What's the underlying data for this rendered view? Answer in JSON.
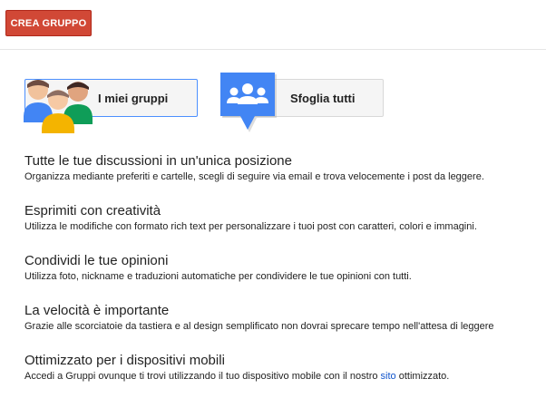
{
  "toolbar": {
    "create_group_label": "CREA GRUPPO"
  },
  "actions": {
    "my_groups_label": "I miei gruppi",
    "my_groups_icon": "people-group-icon",
    "browse_all_label": "Sfoglia tutti",
    "browse_all_icon": "browse-groups-icon"
  },
  "features": [
    {
      "title": "Tutte le tue discussioni in un'unica posizione",
      "desc": "Organizza mediante preferiti e cartelle, scegli di seguire via email e trova velocemente i post da leggere."
    },
    {
      "title": "Esprimiti con creatività",
      "desc": "Utilizza le modifiche con formato rich text per personalizzare i tuoi post con caratteri, colori e immagini."
    },
    {
      "title": "Condividi le tue opinioni",
      "desc": "Utilizza foto, nickname e traduzioni automatiche per condividere le tue opinioni con tutti."
    },
    {
      "title": "La velocità è importante",
      "desc": "Grazie alle scorciatoie da tastiera e al design semplificato non dovrai sprecare tempo nell'attesa di leggere"
    },
    {
      "title": "Ottimizzato per i dispositivi mobili",
      "desc_before": "Accedi a Gruppi ovunque ti trovi utilizzando il tuo dispositivo mobile con il nostro ",
      "desc_link": "sito",
      "desc_after": " ottimizzato."
    }
  ],
  "colors": {
    "create_button": "#d14836",
    "link": "#1155cc",
    "focus_border": "#4d90fe",
    "blue_icon": "#4285f4",
    "green_person": "#0f9d58",
    "yellow_person": "#f4b400"
  }
}
